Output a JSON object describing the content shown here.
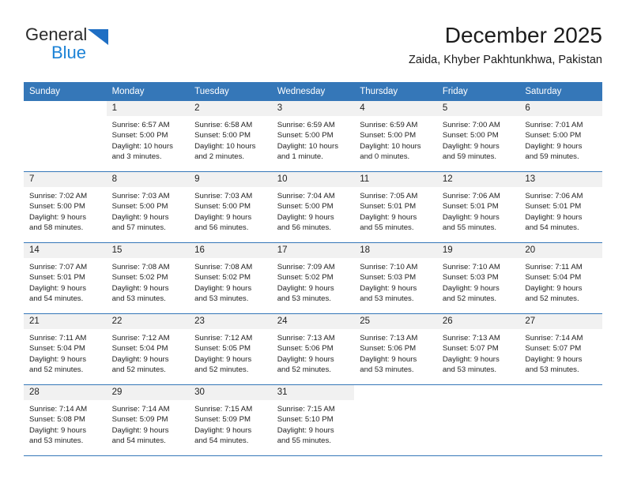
{
  "brand": {
    "name_part1": "General",
    "name_part2": "Blue",
    "triangle_color": "#1f6fc4",
    "blue_text_color": "#1b82d6"
  },
  "header": {
    "title": "December 2025",
    "subtitle": "Zaida, Khyber Pakhtunkhwa, Pakistan"
  },
  "theme": {
    "header_blue": "#3577b8",
    "daynum_gray": "#f1f1f1",
    "grid_line": "#3577b8"
  },
  "weekday_headers": [
    "Sunday",
    "Monday",
    "Tuesday",
    "Wednesday",
    "Thursday",
    "Friday",
    "Saturday"
  ],
  "weeks": [
    [
      {
        "day": "",
        "sunrise": "",
        "sunset": "",
        "daylight_line1": "",
        "daylight_line2": ""
      },
      {
        "day": "1",
        "sunrise": "Sunrise: 6:57 AM",
        "sunset": "Sunset: 5:00 PM",
        "daylight_line1": "Daylight: 10 hours",
        "daylight_line2": "and 3 minutes."
      },
      {
        "day": "2",
        "sunrise": "Sunrise: 6:58 AM",
        "sunset": "Sunset: 5:00 PM",
        "daylight_line1": "Daylight: 10 hours",
        "daylight_line2": "and 2 minutes."
      },
      {
        "day": "3",
        "sunrise": "Sunrise: 6:59 AM",
        "sunset": "Sunset: 5:00 PM",
        "daylight_line1": "Daylight: 10 hours",
        "daylight_line2": "and 1 minute."
      },
      {
        "day": "4",
        "sunrise": "Sunrise: 6:59 AM",
        "sunset": "Sunset: 5:00 PM",
        "daylight_line1": "Daylight: 10 hours",
        "daylight_line2": "and 0 minutes."
      },
      {
        "day": "5",
        "sunrise": "Sunrise: 7:00 AM",
        "sunset": "Sunset: 5:00 PM",
        "daylight_line1": "Daylight: 9 hours",
        "daylight_line2": "and 59 minutes."
      },
      {
        "day": "6",
        "sunrise": "Sunrise: 7:01 AM",
        "sunset": "Sunset: 5:00 PM",
        "daylight_line1": "Daylight: 9 hours",
        "daylight_line2": "and 59 minutes."
      }
    ],
    [
      {
        "day": "7",
        "sunrise": "Sunrise: 7:02 AM",
        "sunset": "Sunset: 5:00 PM",
        "daylight_line1": "Daylight: 9 hours",
        "daylight_line2": "and 58 minutes."
      },
      {
        "day": "8",
        "sunrise": "Sunrise: 7:03 AM",
        "sunset": "Sunset: 5:00 PM",
        "daylight_line1": "Daylight: 9 hours",
        "daylight_line2": "and 57 minutes."
      },
      {
        "day": "9",
        "sunrise": "Sunrise: 7:03 AM",
        "sunset": "Sunset: 5:00 PM",
        "daylight_line1": "Daylight: 9 hours",
        "daylight_line2": "and 56 minutes."
      },
      {
        "day": "10",
        "sunrise": "Sunrise: 7:04 AM",
        "sunset": "Sunset: 5:00 PM",
        "daylight_line1": "Daylight: 9 hours",
        "daylight_line2": "and 56 minutes."
      },
      {
        "day": "11",
        "sunrise": "Sunrise: 7:05 AM",
        "sunset": "Sunset: 5:01 PM",
        "daylight_line1": "Daylight: 9 hours",
        "daylight_line2": "and 55 minutes."
      },
      {
        "day": "12",
        "sunrise": "Sunrise: 7:06 AM",
        "sunset": "Sunset: 5:01 PM",
        "daylight_line1": "Daylight: 9 hours",
        "daylight_line2": "and 55 minutes."
      },
      {
        "day": "13",
        "sunrise": "Sunrise: 7:06 AM",
        "sunset": "Sunset: 5:01 PM",
        "daylight_line1": "Daylight: 9 hours",
        "daylight_line2": "and 54 minutes."
      }
    ],
    [
      {
        "day": "14",
        "sunrise": "Sunrise: 7:07 AM",
        "sunset": "Sunset: 5:01 PM",
        "daylight_line1": "Daylight: 9 hours",
        "daylight_line2": "and 54 minutes."
      },
      {
        "day": "15",
        "sunrise": "Sunrise: 7:08 AM",
        "sunset": "Sunset: 5:02 PM",
        "daylight_line1": "Daylight: 9 hours",
        "daylight_line2": "and 53 minutes."
      },
      {
        "day": "16",
        "sunrise": "Sunrise: 7:08 AM",
        "sunset": "Sunset: 5:02 PM",
        "daylight_line1": "Daylight: 9 hours",
        "daylight_line2": "and 53 minutes."
      },
      {
        "day": "17",
        "sunrise": "Sunrise: 7:09 AM",
        "sunset": "Sunset: 5:02 PM",
        "daylight_line1": "Daylight: 9 hours",
        "daylight_line2": "and 53 minutes."
      },
      {
        "day": "18",
        "sunrise": "Sunrise: 7:10 AM",
        "sunset": "Sunset: 5:03 PM",
        "daylight_line1": "Daylight: 9 hours",
        "daylight_line2": "and 53 minutes."
      },
      {
        "day": "19",
        "sunrise": "Sunrise: 7:10 AM",
        "sunset": "Sunset: 5:03 PM",
        "daylight_line1": "Daylight: 9 hours",
        "daylight_line2": "and 52 minutes."
      },
      {
        "day": "20",
        "sunrise": "Sunrise: 7:11 AM",
        "sunset": "Sunset: 5:04 PM",
        "daylight_line1": "Daylight: 9 hours",
        "daylight_line2": "and 52 minutes."
      }
    ],
    [
      {
        "day": "21",
        "sunrise": "Sunrise: 7:11 AM",
        "sunset": "Sunset: 5:04 PM",
        "daylight_line1": "Daylight: 9 hours",
        "daylight_line2": "and 52 minutes."
      },
      {
        "day": "22",
        "sunrise": "Sunrise: 7:12 AM",
        "sunset": "Sunset: 5:04 PM",
        "daylight_line1": "Daylight: 9 hours",
        "daylight_line2": "and 52 minutes."
      },
      {
        "day": "23",
        "sunrise": "Sunrise: 7:12 AM",
        "sunset": "Sunset: 5:05 PM",
        "daylight_line1": "Daylight: 9 hours",
        "daylight_line2": "and 52 minutes."
      },
      {
        "day": "24",
        "sunrise": "Sunrise: 7:13 AM",
        "sunset": "Sunset: 5:06 PM",
        "daylight_line1": "Daylight: 9 hours",
        "daylight_line2": "and 52 minutes."
      },
      {
        "day": "25",
        "sunrise": "Sunrise: 7:13 AM",
        "sunset": "Sunset: 5:06 PM",
        "daylight_line1": "Daylight: 9 hours",
        "daylight_line2": "and 53 minutes."
      },
      {
        "day": "26",
        "sunrise": "Sunrise: 7:13 AM",
        "sunset": "Sunset: 5:07 PM",
        "daylight_line1": "Daylight: 9 hours",
        "daylight_line2": "and 53 minutes."
      },
      {
        "day": "27",
        "sunrise": "Sunrise: 7:14 AM",
        "sunset": "Sunset: 5:07 PM",
        "daylight_line1": "Daylight: 9 hours",
        "daylight_line2": "and 53 minutes."
      }
    ],
    [
      {
        "day": "28",
        "sunrise": "Sunrise: 7:14 AM",
        "sunset": "Sunset: 5:08 PM",
        "daylight_line1": "Daylight: 9 hours",
        "daylight_line2": "and 53 minutes."
      },
      {
        "day": "29",
        "sunrise": "Sunrise: 7:14 AM",
        "sunset": "Sunset: 5:09 PM",
        "daylight_line1": "Daylight: 9 hours",
        "daylight_line2": "and 54 minutes."
      },
      {
        "day": "30",
        "sunrise": "Sunrise: 7:15 AM",
        "sunset": "Sunset: 5:09 PM",
        "daylight_line1": "Daylight: 9 hours",
        "daylight_line2": "and 54 minutes."
      },
      {
        "day": "31",
        "sunrise": "Sunrise: 7:15 AM",
        "sunset": "Sunset: 5:10 PM",
        "daylight_line1": "Daylight: 9 hours",
        "daylight_line2": "and 55 minutes."
      },
      {
        "day": "",
        "sunrise": "",
        "sunset": "",
        "daylight_line1": "",
        "daylight_line2": ""
      },
      {
        "day": "",
        "sunrise": "",
        "sunset": "",
        "daylight_line1": "",
        "daylight_line2": ""
      },
      {
        "day": "",
        "sunrise": "",
        "sunset": "",
        "daylight_line1": "",
        "daylight_line2": ""
      }
    ]
  ]
}
